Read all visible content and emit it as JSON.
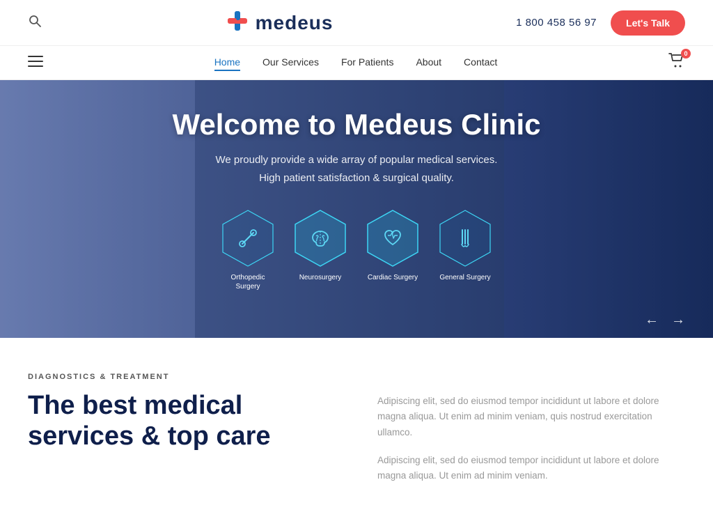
{
  "topbar": {
    "phone": "1 800 458 56 97",
    "lets_talk_label": "Let's Talk",
    "logo_text": "medeus"
  },
  "nav": {
    "items": [
      {
        "label": "Home",
        "active": true
      },
      {
        "label": "Our Services",
        "active": false
      },
      {
        "label": "For Patients",
        "active": false
      },
      {
        "label": "About",
        "active": false
      },
      {
        "label": "Contact",
        "active": false
      }
    ],
    "cart_badge": "0"
  },
  "hero": {
    "title": "Welcome to Medeus Clinic",
    "subtitle_line1": "We proudly provide a wide array of popular medical services.",
    "subtitle_line2": "High patient satisfaction & surgical quality.",
    "services": [
      {
        "label": "Orthopedic\nSurgery",
        "active": false
      },
      {
        "label": "Neurosurgery",
        "active": true
      },
      {
        "label": "Cardiac Surgery",
        "active": true
      },
      {
        "label": "General Surgery",
        "active": false
      }
    ]
  },
  "bottom": {
    "diag_label": "DIAGNOSTICS & TREATMENT",
    "title_line1": "The best medical",
    "title_line2": "services & top care",
    "para1": "Adipiscing elit, sed do eiusmod tempor incididunt ut labore et dolore magna aliqua. Ut enim ad minim veniam, quis nostrud exercitation ullamco.",
    "para2": "Adipiscing elit, sed do eiusmod tempor incididunt ut labore et dolore magna aliqua. Ut enim ad minim veniam."
  },
  "icons": {
    "search": "🔍",
    "hamburger": "☰",
    "cart": "🛒",
    "arrow_left": "←",
    "arrow_right": "→"
  },
  "colors": {
    "accent_blue": "#1a73c1",
    "accent_red": "#f04e4e",
    "nav_blue": "#0f1f4b",
    "hex_cyan": "#3dd6f5"
  }
}
